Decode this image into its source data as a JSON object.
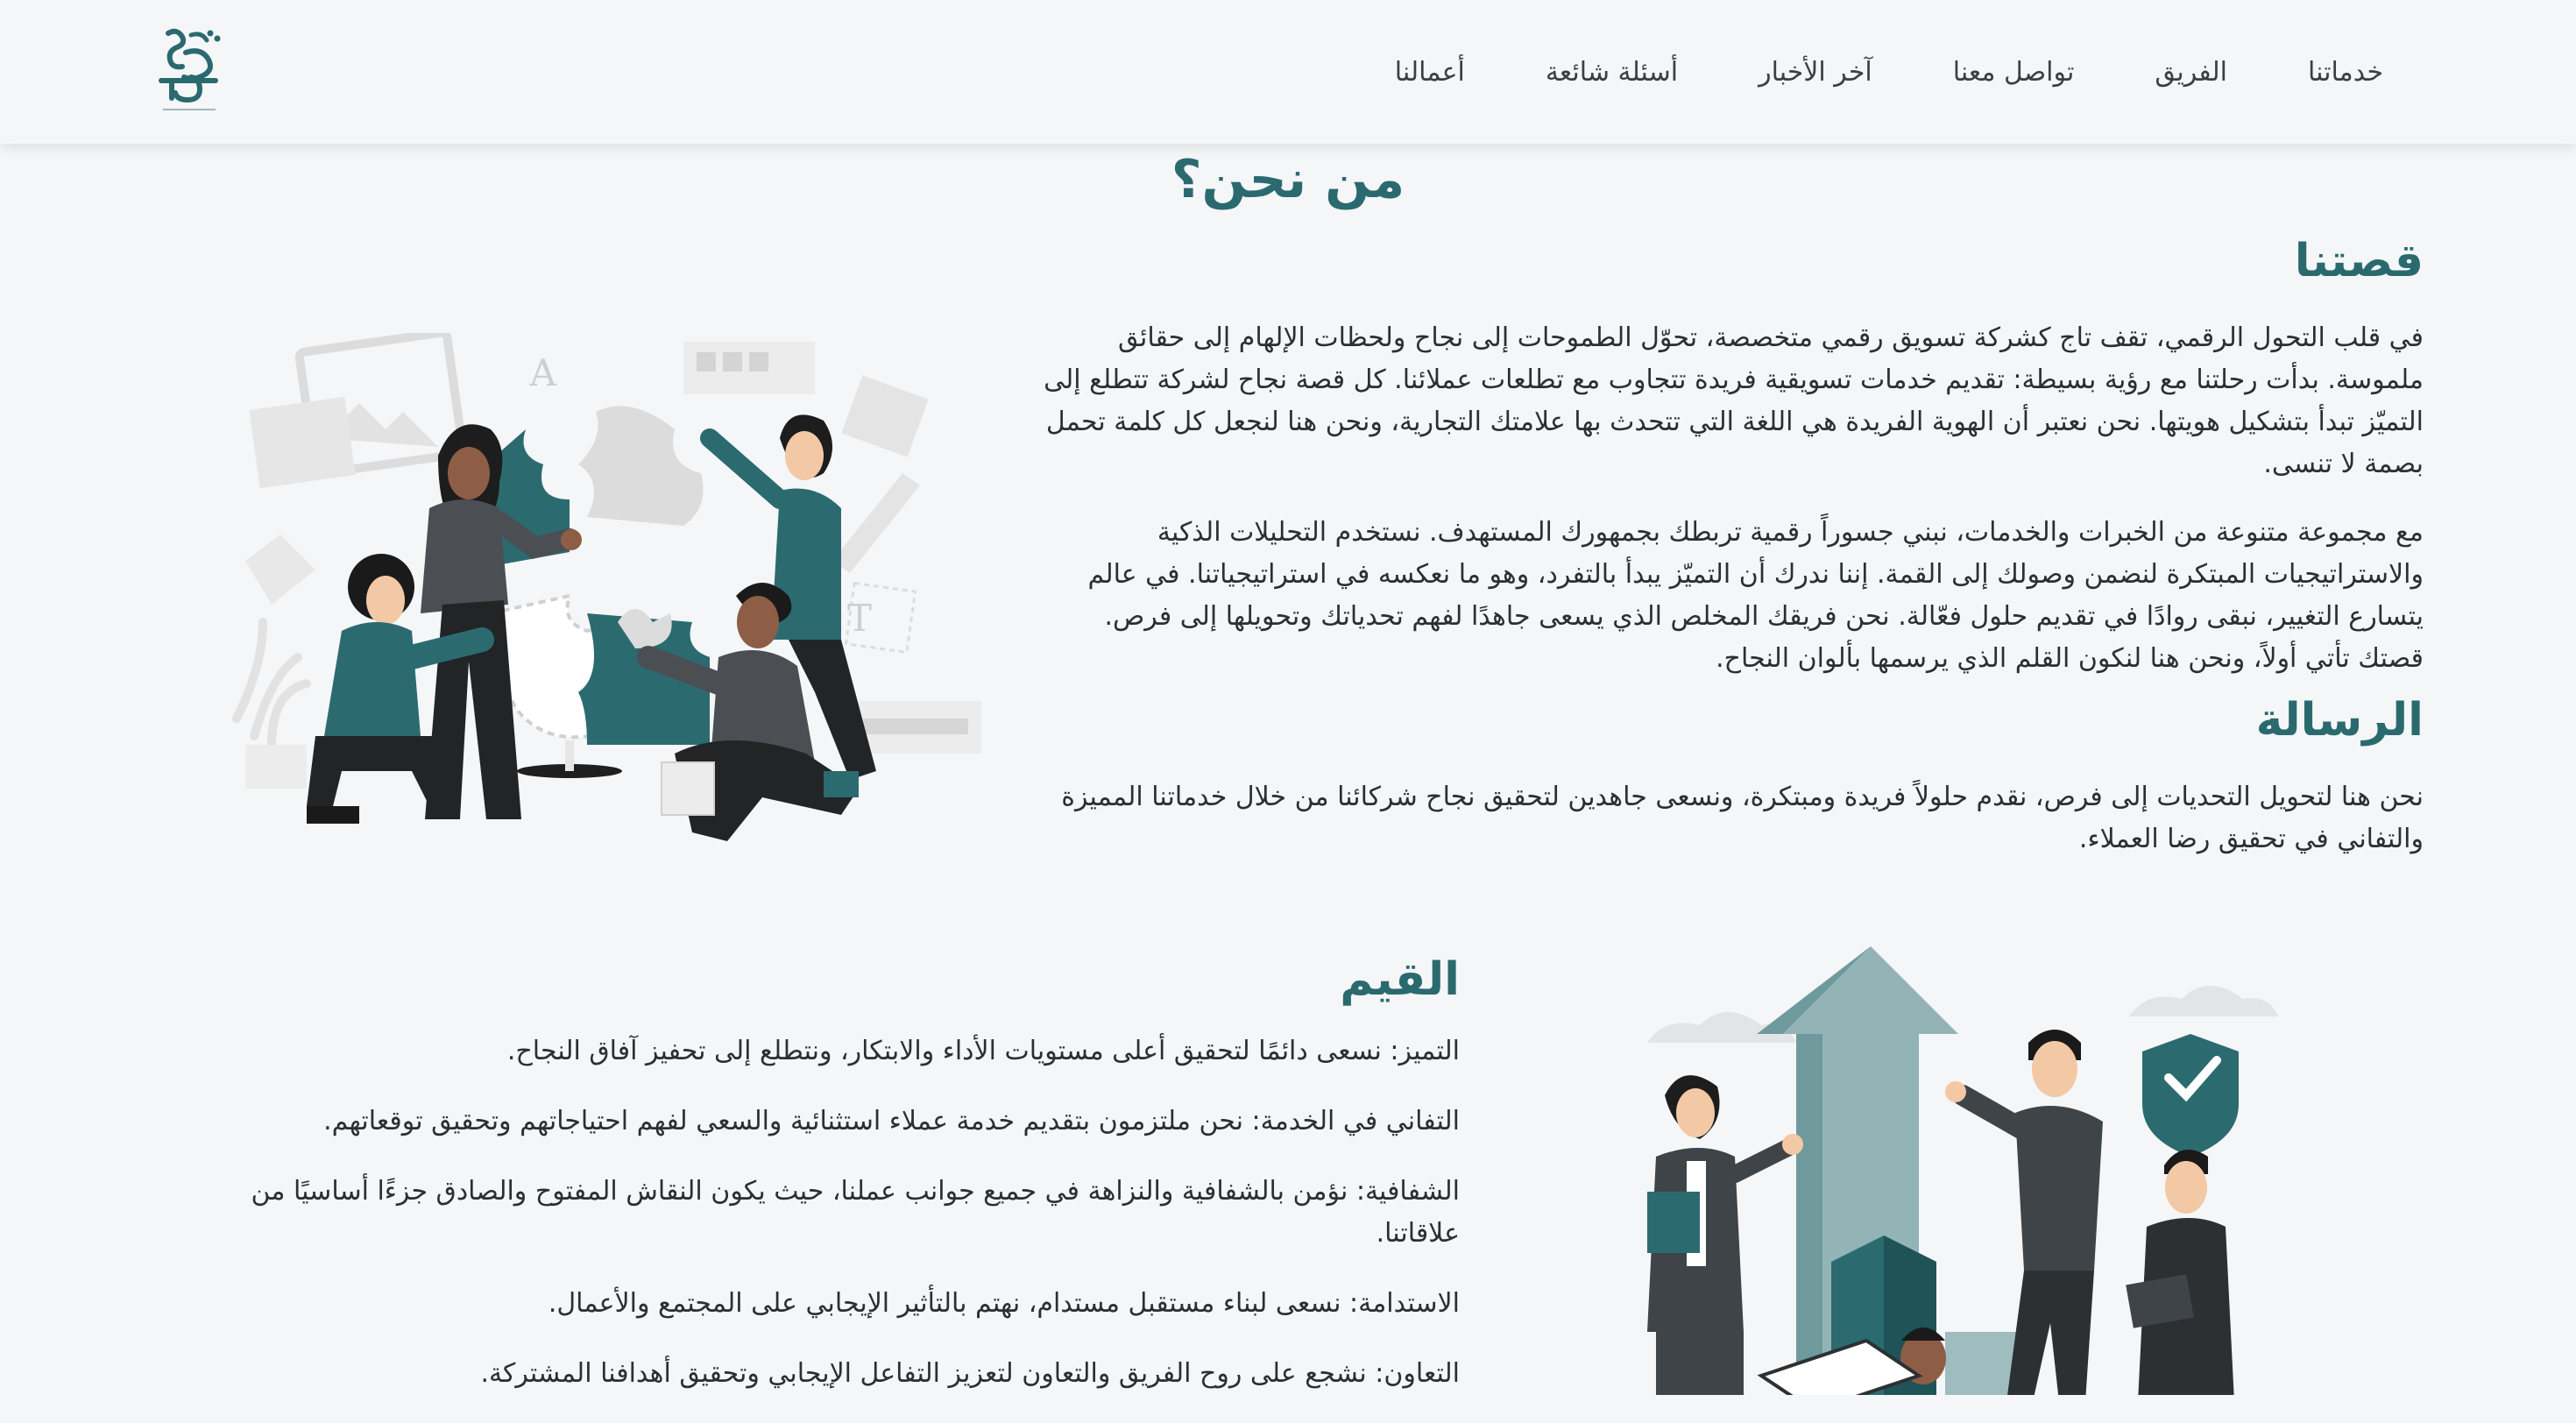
{
  "nav": {
    "items": [
      {
        "label": "خدماتنا"
      },
      {
        "label": "الفريق"
      },
      {
        "label": "تواصل معنا"
      },
      {
        "label": "آخر الأخبار"
      },
      {
        "label": "أسئلة شائعة"
      },
      {
        "label": "أعمالنا"
      }
    ]
  },
  "page": {
    "title": "من نحن؟"
  },
  "story": {
    "heading": "قصتنا",
    "p1": "في قلب التحول الرقمي، تقف تاج كشركة تسويق رقمي متخصصة، تحوّل الطموحات إلى نجاح ولحظات الإلهام إلى حقائق ملموسة. بدأت رحلتنا مع رؤية بسيطة: تقديم خدمات تسويقية فريدة تتجاوب مع تطلعات عملائنا. كل قصة نجاح لشركة تتطلع إلى التميّز تبدأ بتشكيل هويتها. نحن نعتبر أن الهوية الفريدة هي اللغة التي تتحدث بها علامتك التجارية، ونحن هنا لنجعل كل كلمة تحمل بصمة لا تنسى.",
    "p2": "مع مجموعة متنوعة من الخبرات والخدمات، نبني جسوراً رقمية تربطك بجمهورك المستهدف. نستخدم التحليلات الذكية والاستراتيجيات المبتكرة لنضمن وصولك إلى القمة. إننا ندرك أن التميّز يبدأ بالتفرد، وهو ما نعكسه في استراتيجياتنا. في عالم يتسارع التغيير، نبقى روادًا في تقديم حلول فعّالة. نحن فريقك المخلص الذي يسعى جاهدًا لفهم تحدياتك وتحويلها إلى فرص. قصتك تأتي أولاً، ونحن هنا لنكون القلم الذي يرسمها بألوان النجاح."
  },
  "mission": {
    "heading": "الرسالة",
    "p1": "نحن هنا لتحويل التحديات إلى فرص، نقدم حلولاً فريدة ومبتكرة، ونسعى جاهدين لتحقيق نجاح شركائنا من خلال خدماتنا المميزة والتفاني في تحقيق رضا العملاء."
  },
  "values": {
    "heading": "القيم",
    "items": [
      {
        "text": "التميز: نسعى دائمًا لتحقيق أعلى مستويات الأداء والابتكار، ونتطلع إلى تحفيز آفاق النجاح."
      },
      {
        "text": "التفاني في الخدمة: نحن ملتزمون بتقديم خدمة عملاء استثنائية والسعي لفهم احتياجاتهم وتحقيق توقعاتهم."
      },
      {
        "text": "الشفافية: نؤمن بالشفافية والنزاهة في جميع جوانب عملنا، حيث يكون النقاش المفتوح والصادق جزءًا أساسيًا من علاقاتنا."
      },
      {
        "text": "الاستدامة: نسعى لبناء مستقبل مستدام، نهتم بالتأثير الإيجابي على المجتمع والأعمال."
      },
      {
        "text": "التعاون: نشجع على روح الفريق والتعاون لتعزيز التفاعل الإيجابي وتحقيق أهدافنا المشتركة."
      }
    ]
  },
  "colors": {
    "brand_teal": "#2a6a6f",
    "background": "#f5f6f8",
    "text": "#2b2f33"
  },
  "icons": {
    "logo": "taj-logo",
    "team_illustration": "team-puzzle-illustration",
    "growth_illustration": "growth-arrow-illustration"
  }
}
